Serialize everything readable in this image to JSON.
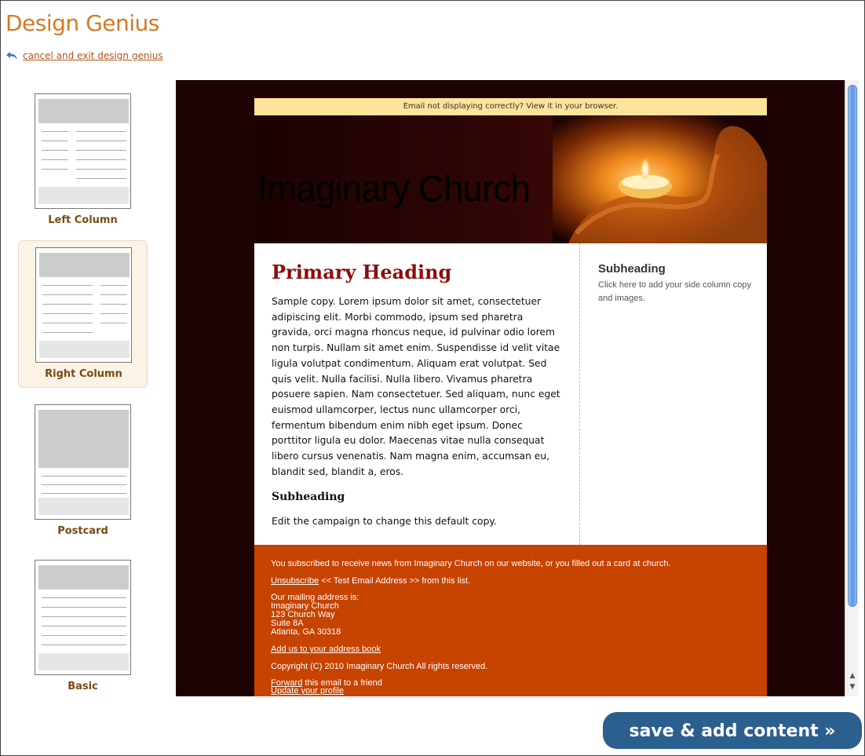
{
  "app": {
    "title": "Design Genius",
    "cancel_link": "cancel and exit design genius"
  },
  "layouts": [
    {
      "label": "Left Column",
      "selected": false
    },
    {
      "label": "Right Column",
      "selected": true
    },
    {
      "label": "Postcard",
      "selected": false
    },
    {
      "label": "Basic",
      "selected": false
    }
  ],
  "email": {
    "notice": "Email not displaying correctly? View it in your browser.",
    "banner_title": "Imaginary Church",
    "primary_heading": "Primary Heading",
    "body_copy": "Sample copy. Lorem ipsum dolor sit amet, consectetuer adipiscing elit. Morbi commodo, ipsum sed pharetra gravida, orci magna rhoncus neque, id pulvinar odio lorem non turpis. Nullam sit amet enim. Suspendisse id velit vitae ligula volutpat condimentum. Aliquam erat volutpat. Sed quis velit. Nulla facilisi. Nulla libero. Vivamus pharetra posuere sapien. Nam consectetuer. Sed aliquam, nunc eget euismod ullamcorper, lectus nunc ullamcorper orci, fermentum bibendum enim nibh eget ipsum. Donec porttitor ligula eu dolor. Maecenas vitae nulla consequat libero cursus venenatis. Nam magna enim, accumsan eu, blandit sed, blandit a, eros.",
    "subheading": "Subheading",
    "sub_copy": "Edit the campaign to change this default copy.",
    "side_heading": "Subheading",
    "side_copy": "Click here to add your side column copy and images.",
    "footer": {
      "subscribed": "You subscribed to receive news from Imaginary Church on our website, or you filled out a card at church.",
      "unsubscribe_link": "Unsubscribe",
      "unsubscribe_rest": " << Test Email Address >> from this list.",
      "mailing_label": "Our mailing address is:",
      "address_lines": [
        "Imaginary Church",
        "123 Church Way",
        "Suite 8A",
        "Atlanta, GA 30318"
      ],
      "add_address_book": "Add us to your address book",
      "copyright": "Copyright (C) 2010 Imaginary Church All rights reserved.",
      "forward_link": "Forward",
      "forward_rest": " this email to a friend",
      "update_profile": "Update your profile"
    }
  },
  "save_button": "save & add content »",
  "colors": {
    "title": "#d47a1e",
    "primary_heading": "#8b0d0d",
    "footer_bg": "#c64300",
    "notice_bg": "#fee39a",
    "save_button_bg": "#2a5f8e"
  }
}
